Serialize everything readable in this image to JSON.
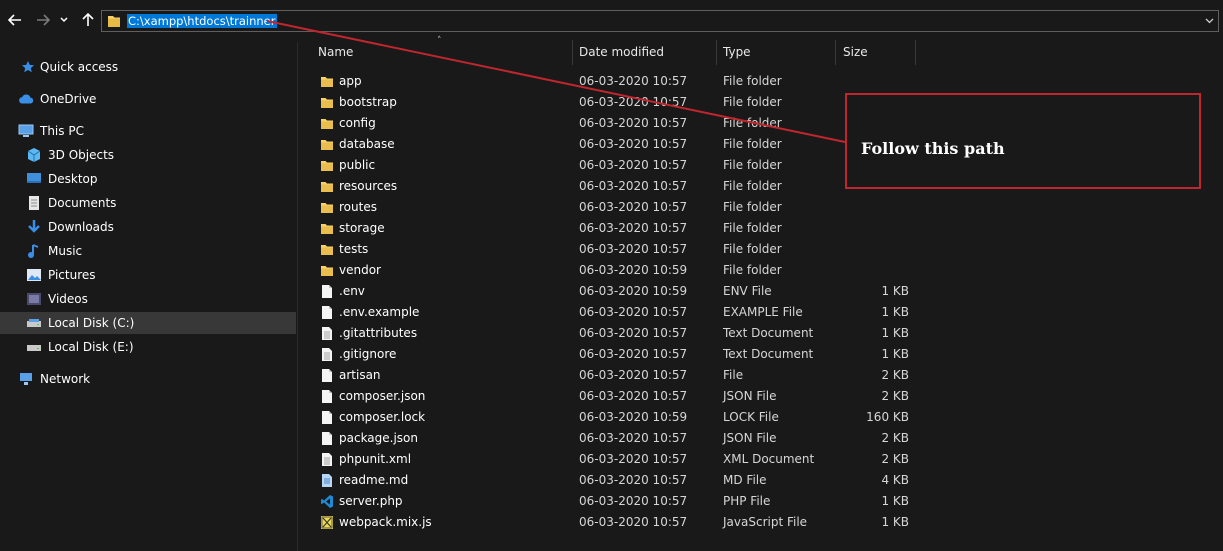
{
  "address_bar": {
    "path": "C:\\xampp\\htdocs\\trainner"
  },
  "sidebar": {
    "items": [
      {
        "label": "Quick access",
        "icon": "star-icon"
      },
      {
        "label": "OneDrive",
        "icon": "cloud-icon"
      },
      {
        "label": "This PC",
        "icon": "computer-icon"
      },
      {
        "label": "3D Objects",
        "icon": "cube-icon"
      },
      {
        "label": "Desktop",
        "icon": "desktop-icon"
      },
      {
        "label": "Documents",
        "icon": "documents-icon"
      },
      {
        "label": "Downloads",
        "icon": "download-icon"
      },
      {
        "label": "Music",
        "icon": "music-icon"
      },
      {
        "label": "Pictures",
        "icon": "pictures-icon"
      },
      {
        "label": "Videos",
        "icon": "videos-icon"
      },
      {
        "label": "Local Disk (C:)",
        "icon": "drive-icon",
        "selected": true
      },
      {
        "label": "Local Disk (E:)",
        "icon": "drive-icon"
      },
      {
        "label": "Network",
        "icon": "network-icon"
      }
    ]
  },
  "columns": {
    "name": "Name",
    "date": "Date modified",
    "type": "Type",
    "size": "Size"
  },
  "files": [
    {
      "name": "app",
      "date": "06-03-2020 10:57",
      "type": "File folder",
      "size": "",
      "icon": "folder-icon"
    },
    {
      "name": "bootstrap",
      "date": "06-03-2020 10:57",
      "type": "File folder",
      "size": "",
      "icon": "folder-icon"
    },
    {
      "name": "config",
      "date": "06-03-2020 10:57",
      "type": "File folder",
      "size": "",
      "icon": "folder-icon"
    },
    {
      "name": "database",
      "date": "06-03-2020 10:57",
      "type": "File folder",
      "size": "",
      "icon": "folder-icon"
    },
    {
      "name": "public",
      "date": "06-03-2020 10:57",
      "type": "File folder",
      "size": "",
      "icon": "folder-icon"
    },
    {
      "name": "resources",
      "date": "06-03-2020 10:57",
      "type": "File folder",
      "size": "",
      "icon": "folder-icon"
    },
    {
      "name": "routes",
      "date": "06-03-2020 10:57",
      "type": "File folder",
      "size": "",
      "icon": "folder-icon"
    },
    {
      "name": "storage",
      "date": "06-03-2020 10:57",
      "type": "File folder",
      "size": "",
      "icon": "folder-icon"
    },
    {
      "name": "tests",
      "date": "06-03-2020 10:57",
      "type": "File folder",
      "size": "",
      "icon": "folder-icon"
    },
    {
      "name": "vendor",
      "date": "06-03-2020 10:59",
      "type": "File folder",
      "size": "",
      "icon": "folder-icon"
    },
    {
      "name": ".env",
      "date": "06-03-2020 10:59",
      "type": "ENV File",
      "size": "1 KB",
      "icon": "file-icon"
    },
    {
      "name": ".env.example",
      "date": "06-03-2020 10:57",
      "type": "EXAMPLE File",
      "size": "1 KB",
      "icon": "file-icon"
    },
    {
      "name": ".gitattributes",
      "date": "06-03-2020 10:57",
      "type": "Text Document",
      "size": "1 KB",
      "icon": "text-file-icon"
    },
    {
      "name": ".gitignore",
      "date": "06-03-2020 10:57",
      "type": "Text Document",
      "size": "1 KB",
      "icon": "text-file-icon"
    },
    {
      "name": "artisan",
      "date": "06-03-2020 10:57",
      "type": "File",
      "size": "2 KB",
      "icon": "file-icon"
    },
    {
      "name": "composer.json",
      "date": "06-03-2020 10:57",
      "type": "JSON File",
      "size": "2 KB",
      "icon": "file-icon"
    },
    {
      "name": "composer.lock",
      "date": "06-03-2020 10:59",
      "type": "LOCK File",
      "size": "160 KB",
      "icon": "file-icon"
    },
    {
      "name": "package.json",
      "date": "06-03-2020 10:57",
      "type": "JSON File",
      "size": "2 KB",
      "icon": "file-icon"
    },
    {
      "name": "phpunit.xml",
      "date": "06-03-2020 10:57",
      "type": "XML Document",
      "size": "2 KB",
      "icon": "text-file-icon"
    },
    {
      "name": "readme.md",
      "date": "06-03-2020 10:57",
      "type": "MD File",
      "size": "4 KB",
      "icon": "markdown-file-icon"
    },
    {
      "name": "server.php",
      "date": "06-03-2020 10:57",
      "type": "PHP File",
      "size": "1 KB",
      "icon": "vscode-icon"
    },
    {
      "name": "webpack.mix.js",
      "date": "06-03-2020 10:57",
      "type": "JavaScript File",
      "size": "1 KB",
      "icon": "js-file-icon"
    }
  ],
  "annotation": {
    "text": "Follow this path",
    "color": "#c0262d"
  },
  "colors": {
    "background": "#191919",
    "selection": "#0078d7",
    "folder": "#f7d26a"
  }
}
